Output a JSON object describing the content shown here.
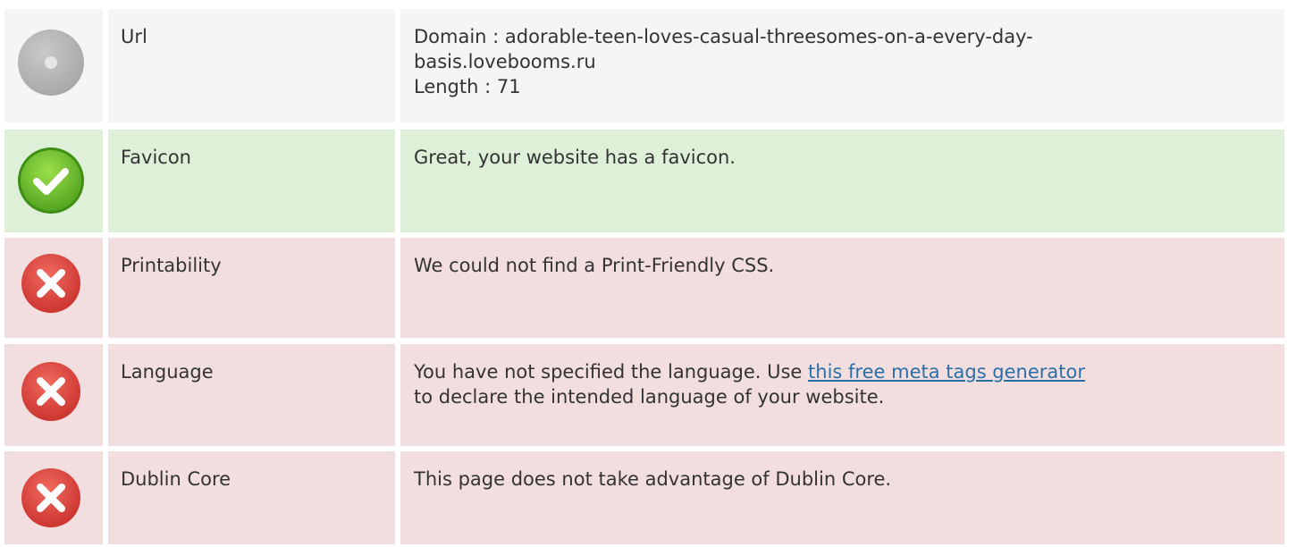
{
  "rows": [
    {
      "status": "neutral",
      "icon": "info-circle-icon",
      "label": "Url",
      "detail_lines": [
        "Domain : adorable-teen-loves-casual-threesomes-on-a-every-day-",
        "basis.lovebooms.ru",
        "Length : 71"
      ]
    },
    {
      "status": "pass",
      "icon": "check-circle-icon",
      "label": "Favicon",
      "detail": "Great, your website has a favicon."
    },
    {
      "status": "fail",
      "icon": "error-circle-icon",
      "label": "Printability",
      "detail": "We could not find a Print-Friendly CSS."
    },
    {
      "status": "fail",
      "icon": "error-circle-icon",
      "label": "Language",
      "detail_before": "You have not specified the language. Use ",
      "detail_link": "this free meta tags generator",
      "detail_after": "to declare the intended language of your website."
    },
    {
      "status": "fail",
      "icon": "error-circle-icon",
      "label": "Dublin Core",
      "detail": "This page does not take advantage of Dublin Core."
    }
  ],
  "colors": {
    "neutral_bg": "#f5f5f5",
    "pass_bg": "#dff0d8",
    "fail_bg": "#f2dede",
    "pass_icon": "#6cbf2a",
    "fail_icon": "#e0473e",
    "neutral_icon": "#b3b3b3",
    "link": "#2a6fa8"
  }
}
